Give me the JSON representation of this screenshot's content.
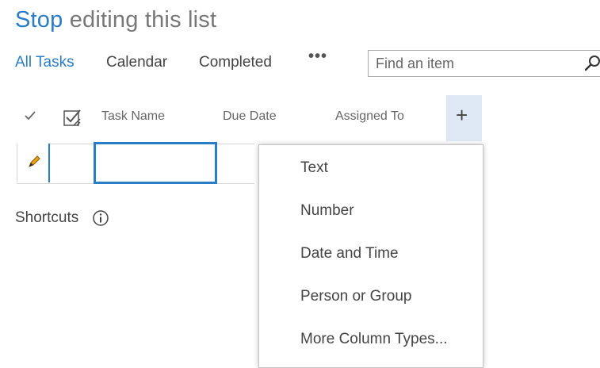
{
  "title": {
    "stop": "Stop",
    "rest": " editing this list"
  },
  "views": [
    {
      "label": "All Tasks",
      "active": true
    },
    {
      "label": "Calendar",
      "active": false
    },
    {
      "label": "Completed",
      "active": false
    }
  ],
  "more_views": "•••",
  "search": {
    "placeholder": "Find an item",
    "icon": "search-icon"
  },
  "columns": [
    "Task Name",
    "Due Date",
    "Assigned To"
  ],
  "add_column": "+",
  "shortcuts": {
    "label": "Shortcuts"
  },
  "column_type_menu": [
    "Text",
    "Number",
    "Date and Time",
    "Person or Group",
    "More Column Types..."
  ],
  "colors": {
    "accent": "#2b7cc7",
    "add_column_bg": "#dfe9f5",
    "pencil": "#e8a317"
  }
}
